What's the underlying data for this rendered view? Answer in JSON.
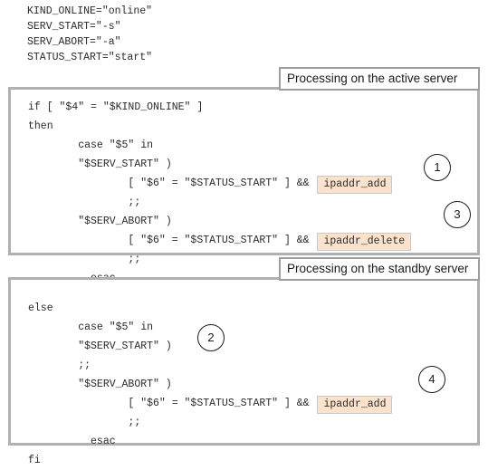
{
  "preamble": {
    "lines": [
      "KIND_ONLINE=\"online\"",
      "SERV_START=\"-s\"",
      "SERV_ABORT=\"-a\"",
      "STATUS_START=\"start\""
    ]
  },
  "colors": {
    "panel_border": "#b0b0b0",
    "header_border": "#9e9e9e",
    "chip_background": "#fae2cd",
    "chip_border": "#c9c9c9",
    "text": "#2b2b2b",
    "marker_stroke": "#1a1a1a",
    "page_background": "#ffffff"
  },
  "panels": [
    {
      "id": "active",
      "header": "Processing on the active server",
      "code_lines": [
        {
          "pre": "if [ \"$4\" = \"$KIND_ONLINE\" ]",
          "chip": null,
          "post": ""
        },
        {
          "pre": "then",
          "chip": null,
          "post": ""
        },
        {
          "pre": "        case \"$5\" in",
          "chip": null,
          "post": ""
        },
        {
          "pre": "        \"$SERV_START\" )",
          "chip": null,
          "post": ""
        },
        {
          "pre": "                [ \"$6\" = \"$STATUS_START\" ] && ",
          "chip": "ipaddr_add",
          "post": ""
        },
        {
          "pre": "                ;;",
          "chip": null,
          "post": ""
        },
        {
          "pre": "        \"$SERV_ABORT\" )",
          "chip": null,
          "post": ""
        },
        {
          "pre": "                [ \"$6\" = \"$STATUS_START\" ] && ",
          "chip": "ipaddr_delete",
          "post": ""
        },
        {
          "pre": "                ;;",
          "chip": null,
          "post": ""
        },
        {
          "pre": "          esac",
          "chip": null,
          "post": ""
        }
      ]
    },
    {
      "id": "standby",
      "header": "Processing on the standby server",
      "code_lines": [
        {
          "pre": "else",
          "chip": null,
          "post": ""
        },
        {
          "pre": "        case \"$5\" in",
          "chip": null,
          "post": ""
        },
        {
          "pre": "        \"$SERV_START\" )",
          "chip": null,
          "post": ""
        },
        {
          "pre": "        ;;",
          "chip": null,
          "post": ""
        },
        {
          "pre": "        \"$SERV_ABORT\" )",
          "chip": null,
          "post": ""
        },
        {
          "pre": "                [ \"$6\" = \"$STATUS_START\" ] && ",
          "chip": "ipaddr_add",
          "post": ""
        },
        {
          "pre": "                ;;",
          "chip": null,
          "post": ""
        },
        {
          "pre": "          esac",
          "chip": null,
          "post": ""
        },
        {
          "pre": "fi",
          "chip": null,
          "post": ""
        }
      ]
    }
  ],
  "markers": [
    {
      "id": "marker-1",
      "label": "1",
      "refers_to": "ipaddr_add on active server start"
    },
    {
      "id": "marker-3",
      "label": "3",
      "refers_to": "ipaddr_delete on active server abort"
    },
    {
      "id": "marker-2",
      "label": "2",
      "refers_to": "no action on standby server start"
    },
    {
      "id": "marker-4",
      "label": "4",
      "refers_to": "ipaddr_add on standby server abort"
    }
  ]
}
